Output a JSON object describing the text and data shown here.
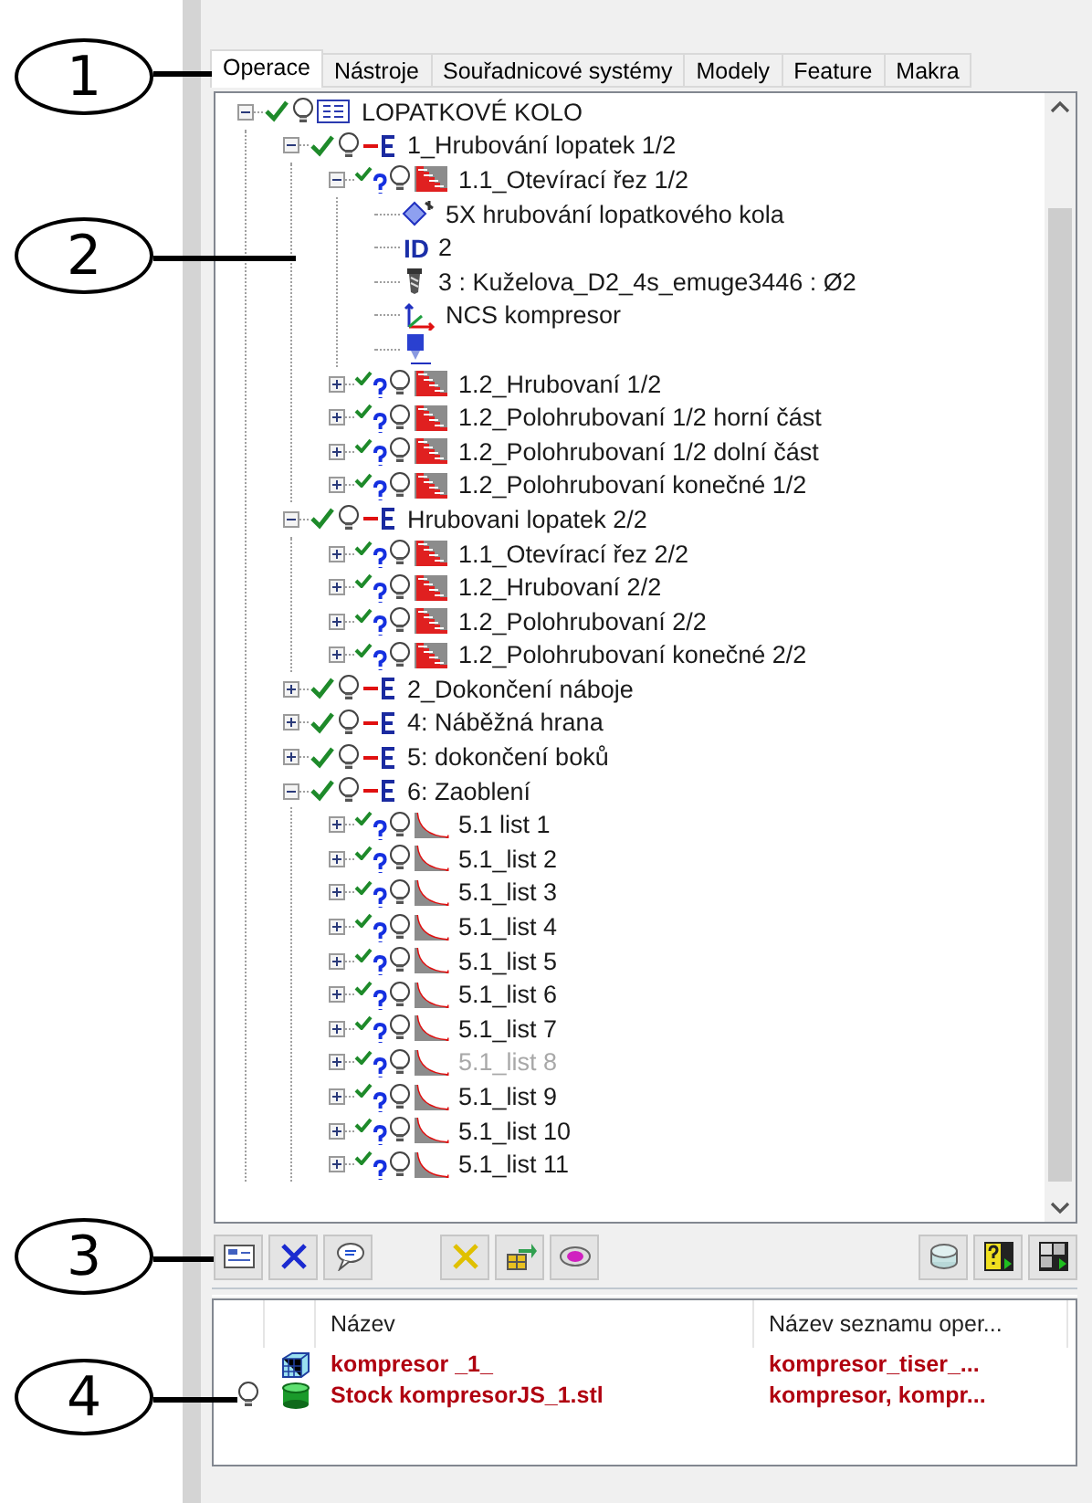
{
  "callouts": [
    "1",
    "2",
    "3",
    "4"
  ],
  "tabs": [
    {
      "label": "Operace",
      "selected": true
    },
    {
      "label": "Nástroje",
      "selected": false
    },
    {
      "label": "Souřadnicové systémy",
      "selected": false
    },
    {
      "label": "Modely",
      "selected": false
    },
    {
      "label": "Feature",
      "selected": false
    },
    {
      "label": "Makra",
      "selected": false
    }
  ],
  "tree": [
    {
      "kind": "project",
      "label": "LOPATKOVÉ KOLO",
      "expanded": true,
      "children": [
        {
          "kind": "group",
          "label": "1_Hrubování lopatek 1/2",
          "expanded": true,
          "children": [
            {
              "kind": "roughing",
              "label": "1.1_Otevírací řez 1/2",
              "expanded": true,
              "disabled": false,
              "children": [
                {
                  "kind": "strategy",
                  "label": "5X hrubování lopatkového kola"
                },
                {
                  "kind": "id",
                  "icon_text": "ID",
                  "label": "2"
                },
                {
                  "kind": "tool",
                  "label": "3 : Kuželova_D2_4s_emuge3446 : Ø2"
                },
                {
                  "kind": "ncs",
                  "label": "NCS kompresor"
                },
                {
                  "kind": "holder"
                }
              ]
            },
            {
              "kind": "roughing",
              "label": "1.2_Hrubovaní 1/2",
              "expanded": false,
              "disabled": false
            },
            {
              "kind": "roughing",
              "label": "1.2_Polohrubovaní 1/2 horní část",
              "expanded": false,
              "disabled": false
            },
            {
              "kind": "roughing",
              "label": "1.2_Polohrubovaní 1/2 dolní část",
              "expanded": false,
              "disabled": false
            },
            {
              "kind": "roughing",
              "label": "1.2_Polohrubovaní konečné 1/2",
              "expanded": false,
              "disabled": false
            }
          ]
        },
        {
          "kind": "group",
          "label": "Hrubovani lopatek 2/2",
          "expanded": true,
          "children": [
            {
              "kind": "roughing",
              "label": "1.1_Otevírací řez 2/2",
              "expanded": false,
              "disabled": false
            },
            {
              "kind": "roughing",
              "label": "1.2_Hrubovaní 2/2",
              "expanded": false,
              "disabled": false
            },
            {
              "kind": "roughing",
              "label": "1.2_Polohrubovaní 2/2",
              "expanded": false,
              "disabled": false
            },
            {
              "kind": "roughing",
              "label": "1.2_Polohrubovaní konečné 2/2",
              "expanded": false,
              "disabled": false
            }
          ]
        },
        {
          "kind": "group",
          "label": "2_Dokončení náboje",
          "expanded": false
        },
        {
          "kind": "group",
          "label": "4: Náběžná hrana",
          "expanded": false
        },
        {
          "kind": "group",
          "label": "5: dokončení boků",
          "expanded": false
        },
        {
          "kind": "group",
          "label": "6: Zaoblení",
          "expanded": true,
          "children": [
            {
              "kind": "finishing",
              "label": "5.1 list 1",
              "expanded": false,
              "disabled": false
            },
            {
              "kind": "finishing",
              "label": "5.1_list 2",
              "expanded": false,
              "disabled": false
            },
            {
              "kind": "finishing",
              "label": "5.1_list 3",
              "expanded": false,
              "disabled": false
            },
            {
              "kind": "finishing",
              "label": "5.1_list 4",
              "expanded": false,
              "disabled": false
            },
            {
              "kind": "finishing",
              "label": "5.1_list 5",
              "expanded": false,
              "disabled": false
            },
            {
              "kind": "finishing",
              "label": "5.1_list 6",
              "expanded": false,
              "disabled": false
            },
            {
              "kind": "finishing",
              "label": "5.1_list 7",
              "expanded": false,
              "disabled": false
            },
            {
              "kind": "finishing",
              "label": "5.1_list 8",
              "expanded": false,
              "disabled": true
            },
            {
              "kind": "finishing",
              "label": "5.1_list 9",
              "expanded": false,
              "disabled": false
            },
            {
              "kind": "finishing",
              "label": "5.1_list 10",
              "expanded": false,
              "disabled": false
            },
            {
              "kind": "finishing",
              "label": "5.1_list 11",
              "expanded": false,
              "disabled": false
            }
          ]
        }
      ]
    }
  ],
  "table": {
    "columns": [
      "Název",
      "Název seznamu oper..."
    ],
    "rows": [
      {
        "kind": "model",
        "visible": false,
        "cells": [
          "kompresor _1_",
          "kompresor_tiser_..."
        ]
      },
      {
        "kind": "stock",
        "visible": true,
        "cells": [
          "Stock kompresorJS_1.stl",
          "kompresor, kompr..."
        ]
      }
    ]
  }
}
